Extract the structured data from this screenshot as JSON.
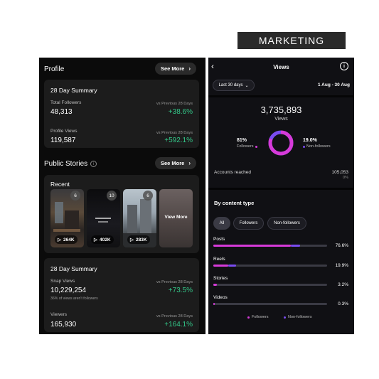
{
  "badge": "MARKETING",
  "left": {
    "profile_title": "Profile",
    "see_more": "See More",
    "summary1": {
      "title": "28 Day Summary",
      "followers_label": "Total Followers",
      "followers_value": "48,313",
      "vs_label": "vs Previous 28 Days",
      "followers_change": "+38.6%",
      "views_label": "Profile Views",
      "views_value": "119,587",
      "views_change": "+592.1%"
    },
    "stories_title": "Public Stories",
    "recent": {
      "title": "Recent",
      "items": [
        {
          "count": "6",
          "views": "264K"
        },
        {
          "count": "10",
          "views": "402K"
        },
        {
          "count": "6",
          "views": "283K"
        }
      ],
      "view_more": "View More"
    },
    "summary2": {
      "title": "28 Day Summary",
      "snap_label": "Snap Views",
      "snap_value": "10,229,254",
      "snap_note": "36% of views aren't followers",
      "snap_change": "+73.5%",
      "viewers_label": "Viewers",
      "viewers_value": "165,930",
      "viewers_change": "+164.1%",
      "vs_label": "vs Previous 28 Days"
    }
  },
  "right": {
    "title": "Views",
    "back_icon": "chevron-left-icon",
    "info_icon": "info-icon",
    "range_button": "Last 30 days",
    "date_range": "1 Aug - 30 Aug",
    "total_views": "3,735,893",
    "views_label": "Views",
    "followers_pct": "81%",
    "followers_label": "Followers",
    "nonfollowers_pct": "19.0%",
    "nonfollowers_label": "Non-followers",
    "followers_share": 0.81,
    "accounts_label": "Accounts reached",
    "accounts_value": "105,053",
    "accounts_change": "0%",
    "content_title": "By content type",
    "filters": [
      "All",
      "Followers",
      "Non-followers"
    ],
    "rows": [
      {
        "label": "Posts",
        "pct": "76.6%",
        "followers": 0.68,
        "nonfollowers": 0.08
      },
      {
        "label": "Reels",
        "pct": "19.9%",
        "followers": 0.13,
        "nonfollowers": 0.07
      },
      {
        "label": "Stories",
        "pct": "3.2%",
        "followers": 0.03,
        "nonfollowers": 0.0
      },
      {
        "label": "Videos",
        "pct": "0.3%",
        "followers": 0.003,
        "nonfollowers": 0.0
      }
    ],
    "legend": {
      "followers": "Followers",
      "nonfollowers": "Non-followers"
    },
    "colors": {
      "followers": "#d63ad9",
      "nonfollowers": "#7a4cf0"
    }
  }
}
